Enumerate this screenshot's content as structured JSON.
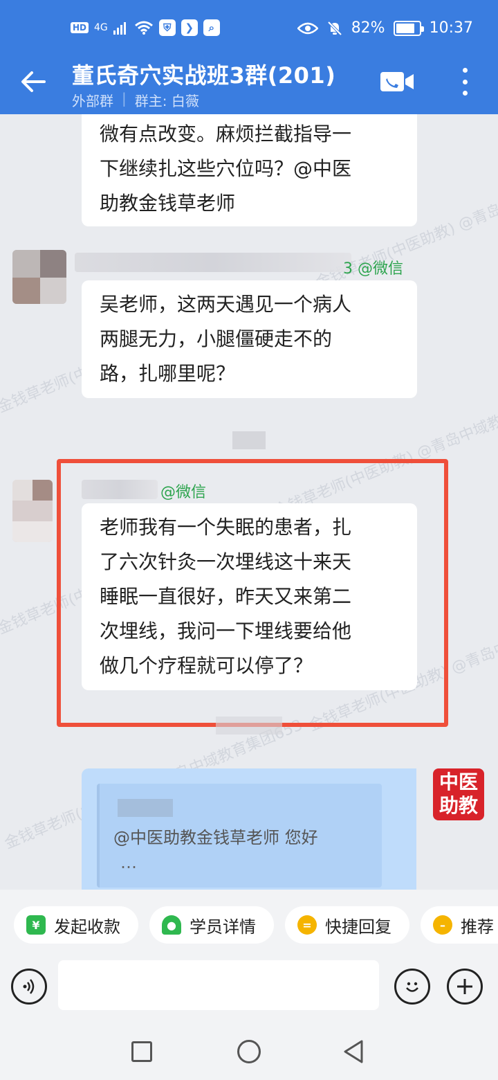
{
  "status_bar": {
    "hd": "HD",
    "network": "4G",
    "battery_percent": "82%",
    "time": "10:37",
    "battery_level": 0.82
  },
  "header": {
    "title": "董氏奇穴实战班3群(201)",
    "tag": "外部群",
    "owner": "群主: 白薇"
  },
  "messages": [
    {
      "type": "incoming",
      "text_lines": [
        "微有点改变。麻烦拦截指导一",
        "下继续扎这些穴位吗？@中医",
        "助教金钱草老师"
      ]
    },
    {
      "type": "incoming",
      "sender_suffix": "3 @微信",
      "text_lines": [
        "吴老师，这两天遇见一个病人",
        "两腿无力，小腿僵硬走不的",
        "路，扎哪里呢？"
      ]
    },
    {
      "type": "incoming",
      "highlighted": true,
      "sender_suffix": "@微信",
      "text_lines": [
        "老师我有一个失眠的患者，扎",
        "了六次针灸一次埋线这十来天",
        "睡眠一直很好，昨天又来第二",
        "次埋线，我问一下埋线要给他",
        "做几个疗程就可以停了？"
      ]
    },
    {
      "type": "outgoing",
      "quote_text": "@中医助教金钱草老师 您好",
      "quote_more": "…",
      "avatar_text": [
        "中医",
        "助教"
      ]
    }
  ],
  "watermark": "金钱草老师(中医助教) @青岛中域教育集团653",
  "quick_actions": [
    {
      "label": "发起收款",
      "icon": "payment-icon",
      "color": "#2fb84f"
    },
    {
      "label": "学员详情",
      "icon": "student-icon",
      "color": "#2fb84f"
    },
    {
      "label": "快捷回复",
      "icon": "quick-reply-icon",
      "color": "#f5b400"
    },
    {
      "label": "推荐",
      "icon": "recommend-icon",
      "color": "#f5b400"
    }
  ],
  "input": {
    "placeholder": ""
  },
  "colors": {
    "header_bg": "#3a7de0",
    "highlight_border": "#ef4f3a",
    "outgoing_bubble": "#bfdcfb",
    "wechat_green": "#2da44e"
  }
}
